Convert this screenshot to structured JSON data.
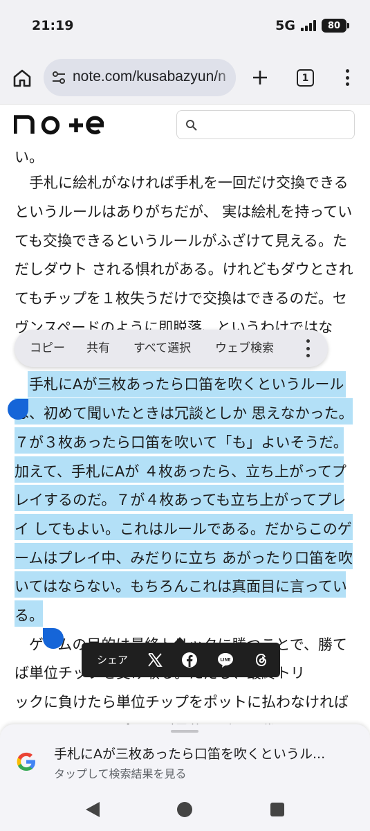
{
  "status": {
    "time": "21:19",
    "network": "5G",
    "battery": "80"
  },
  "browser": {
    "url": "note.com/kusabazyun/n",
    "tab_count": "1"
  },
  "note": {
    "logo_text": "note",
    "search_placeholder": ""
  },
  "article": {
    "lines": [
      "い。",
      "　手札に絵札がなければ手札を一回だけ交換できる",
      "というルールはありがちだが、 実は絵札を持ってい",
      "ても交換できるというルールがふざけて見える。た",
      "だしダウト される惧れがある。けれどもダウとされ",
      "てもチップを１枚失うだけで交換はできるのだ。セ",
      "ヴンスペードのように即脱落、というわけではな",
      "",
      "　手札にAが三枚あったら口笛を吹くというルール",
      "は、初めて聞いたときは冗談としか 思えなかった。",
      "７が３枚あったら口笛を吹いて「も」よいそうだ。",
      "加えて、手札にAが ４枚あったら、立ち上がってプ",
      "レイするのだ。７が４枚あっても立ち上がってプレ",
      "イ してもよい。これはルールである。だからこのゲ",
      "ームはプレイ中、みだりに立ち あがったり口笛を吹",
      "いてはならない。もちろんこれは真面目に言ってい",
      "る。",
      "　ゲームの目的は最終トリックに勝つことで、勝て",
      "ば単位チップを受け取る。ただし、最終トリ",
      "ックに負けたら単位チップをポットに払わなければ",
      "ならない。このポットが最後にゲーム代になるわけ"
    ]
  },
  "context_menu": {
    "copy": "コピー",
    "share": "共有",
    "select_all": "すべて選択",
    "web_search": "ウェブ検索"
  },
  "share_bar": {
    "label": "シェア",
    "icons": [
      "x-icon",
      "facebook-icon",
      "line-icon",
      "threads-icon"
    ]
  },
  "search_sheet": {
    "query": "手札にAが三枚あったら口笛を吹くというル...",
    "subtitle": "タップして検索結果を見る"
  },
  "colors": {
    "selection": "#b3e0f7",
    "handle": "#1565d8",
    "chrome_bg": "#f1f1f4"
  }
}
